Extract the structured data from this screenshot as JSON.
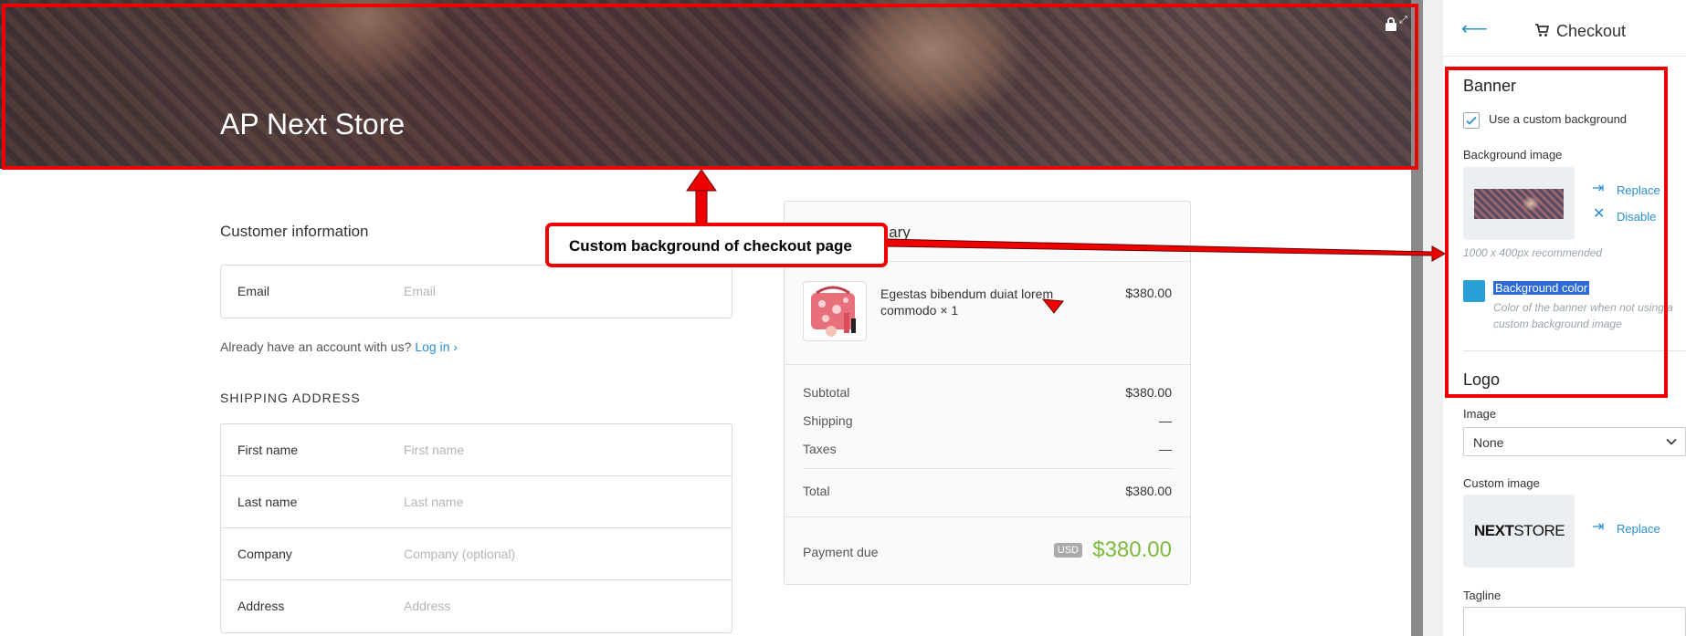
{
  "banner": {
    "title": "AP Next Store"
  },
  "customer_info": {
    "title": "Customer information",
    "email_label": "Email",
    "email_placeholder": "Email",
    "login_prompt": "Already have an account with us?",
    "login_link": "Log in"
  },
  "shipping": {
    "title": "SHIPPING ADDRESS",
    "fields": [
      {
        "label": "First name",
        "placeholder": "First name"
      },
      {
        "label": "Last name",
        "placeholder": "Last name"
      },
      {
        "label": "Company",
        "placeholder": "Company (optional)"
      },
      {
        "label": "Address",
        "placeholder": "Address"
      }
    ]
  },
  "summary": {
    "title": "mary",
    "product_name": "Egestas bibendum duiat lorem commodo × 1",
    "product_price": "$380.00",
    "subtotal_label": "Subtotal",
    "subtotal_value": "$380.00",
    "shipping_label": "Shipping",
    "shipping_value": "—",
    "taxes_label": "Taxes",
    "taxes_value": "—",
    "total_label": "Total",
    "total_value": "$380.00",
    "payment_label": "Payment due",
    "currency_badge": "USD",
    "payment_total": "$380.00"
  },
  "annotation": {
    "text": "Custom background of checkout page"
  },
  "panel": {
    "title": "Checkout",
    "banner_heading": "Banner",
    "custom_bg_checkbox_label": "Use a custom background",
    "custom_bg_checked": true,
    "bg_image_label": "Background image",
    "replace_label": "Replace",
    "disable_label": "Disable",
    "bg_hint": "1000 x 400px recommended",
    "bg_color_label": "Background color",
    "bg_color_value": "#2a9fd6",
    "bg_color_hint": "Color of the banner when not using a custom background image",
    "logo_heading": "Logo",
    "image_label": "Image",
    "image_select_value": "None",
    "custom_image_label": "Custom image",
    "custom_image_replace_label": "Replace",
    "logo_text_bold": "NEXT",
    "logo_text_regular": "STORE",
    "tagline_label": "Tagline"
  },
  "colors": {
    "accent": "#2a8fd1",
    "annotation_red": "#e00000",
    "payment_green": "#7dba3d"
  }
}
